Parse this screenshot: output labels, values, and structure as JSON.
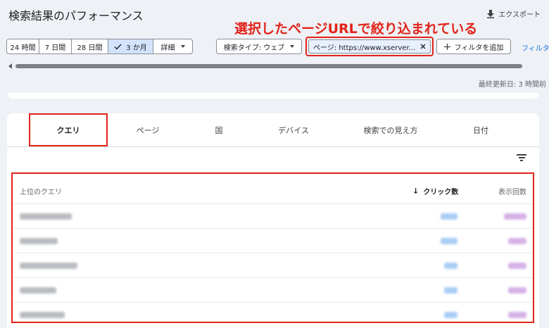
{
  "header": {
    "title": "検索結果のパフォーマンス",
    "export_label": "エクスポート",
    "annotation": "選択したページURLで絞り込まれている"
  },
  "date_range": {
    "options": [
      "24 時間",
      "7 日間",
      "28 日間",
      "3 か月",
      "詳細"
    ],
    "selected": "3 か月"
  },
  "filters": {
    "search_type": "検索タイプ: ウェブ",
    "page_filter": "ページ: https://www.xserver...",
    "add_filter": "フィルタを追加",
    "filter_link": "フィルタ"
  },
  "last_updated": "最終更新日: 3 時間前",
  "tabs": [
    "クエリ",
    "ページ",
    "国",
    "デバイス",
    "検索での見え方",
    "日付"
  ],
  "active_tab": "クエリ",
  "table": {
    "headers": {
      "query": "上位のクエリ",
      "clicks": "クリック数",
      "impressions": "表示回数"
    },
    "sort_indicator": "↓",
    "row_count": 5
  },
  "colors": {
    "annotation_red": "#e2231a",
    "selected_segment": "#d3e3fd",
    "link_blue": "#1a73e8"
  },
  "icons": [
    "download-icon",
    "checkmark-icon",
    "close-icon",
    "plus-icon",
    "filter-list-icon",
    "arrow-down-icon"
  ]
}
